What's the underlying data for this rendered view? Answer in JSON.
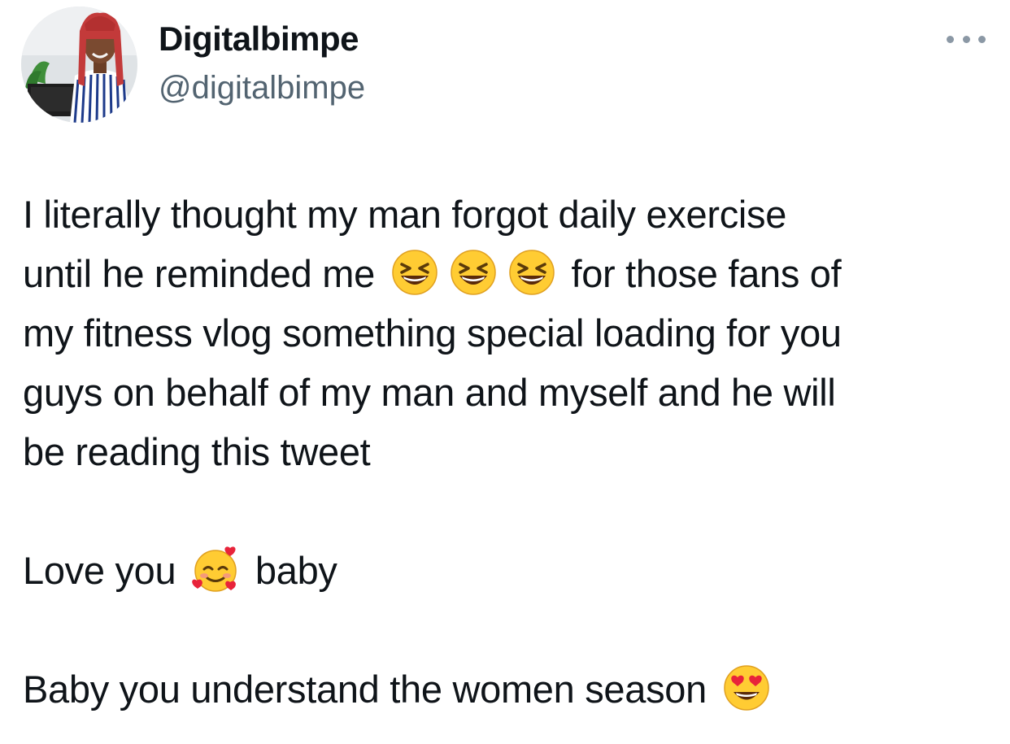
{
  "author": {
    "display_name": "Digitalbimpe",
    "handle": "@digitalbimpe"
  },
  "icons": {
    "more": "more-horizontal-icon",
    "avatar": "profile-photo"
  },
  "tweet": {
    "line1": "I literally thought my man forgot daily exercise",
    "line2_before": "until he reminded me",
    "line2_after": "for those fans of",
    "line3": "my fitness vlog something special loading for you",
    "line4": "guys on behalf of my man and myself and he will",
    "line5": "be reading this tweet",
    "love_before": "Love you",
    "love_after": "baby",
    "last_line": "Baby you understand the women season",
    "emojis": [
      "grinning-squinting-face",
      "grinning-squinting-face",
      "grinning-squinting-face",
      "smiling-face-with-hearts",
      "heart-eyes-face"
    ]
  }
}
